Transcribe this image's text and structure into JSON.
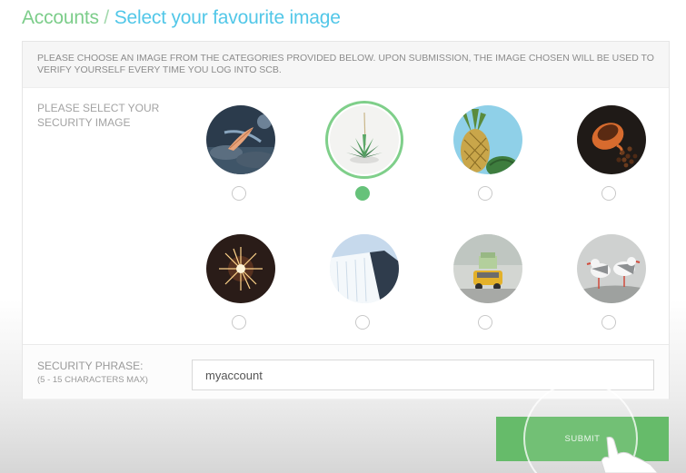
{
  "header": {
    "section": "Accounts",
    "separator": " / ",
    "page_title": "Select your favourite image"
  },
  "notice": {
    "text": "PLEASE CHOOSE AN IMAGE FROM THE CATEGORIES PROVIDED BELOW. UPON SUBMISSION, THE IMAGE CHOSEN WILL BE USED TO VERIFY YOURSELF EVERY TIME YOU LOG INTO SCB."
  },
  "security_image": {
    "label": "PLEASE SELECT YOUR SECURITY IMAGE",
    "selected_index": 1,
    "options": [
      {
        "name": "feather-on-rocks-image"
      },
      {
        "name": "succulent-plant-image"
      },
      {
        "name": "pineapple-image"
      },
      {
        "name": "coffee-cup-image"
      },
      {
        "name": "sparkler-image"
      },
      {
        "name": "waterfall-image"
      },
      {
        "name": "toy-car-image"
      },
      {
        "name": "seagulls-image"
      }
    ]
  },
  "security_phrase": {
    "label": "SECURITY PHRASE:",
    "hint": "(5 - 15 CHARACTERS MAX)",
    "value": "myaccount"
  },
  "submit": {
    "label": "SUBMIT"
  },
  "colors": {
    "accent_green": "#66bb6a",
    "title_blue": "#52c7e8",
    "title_green": "#7ccd8a"
  }
}
